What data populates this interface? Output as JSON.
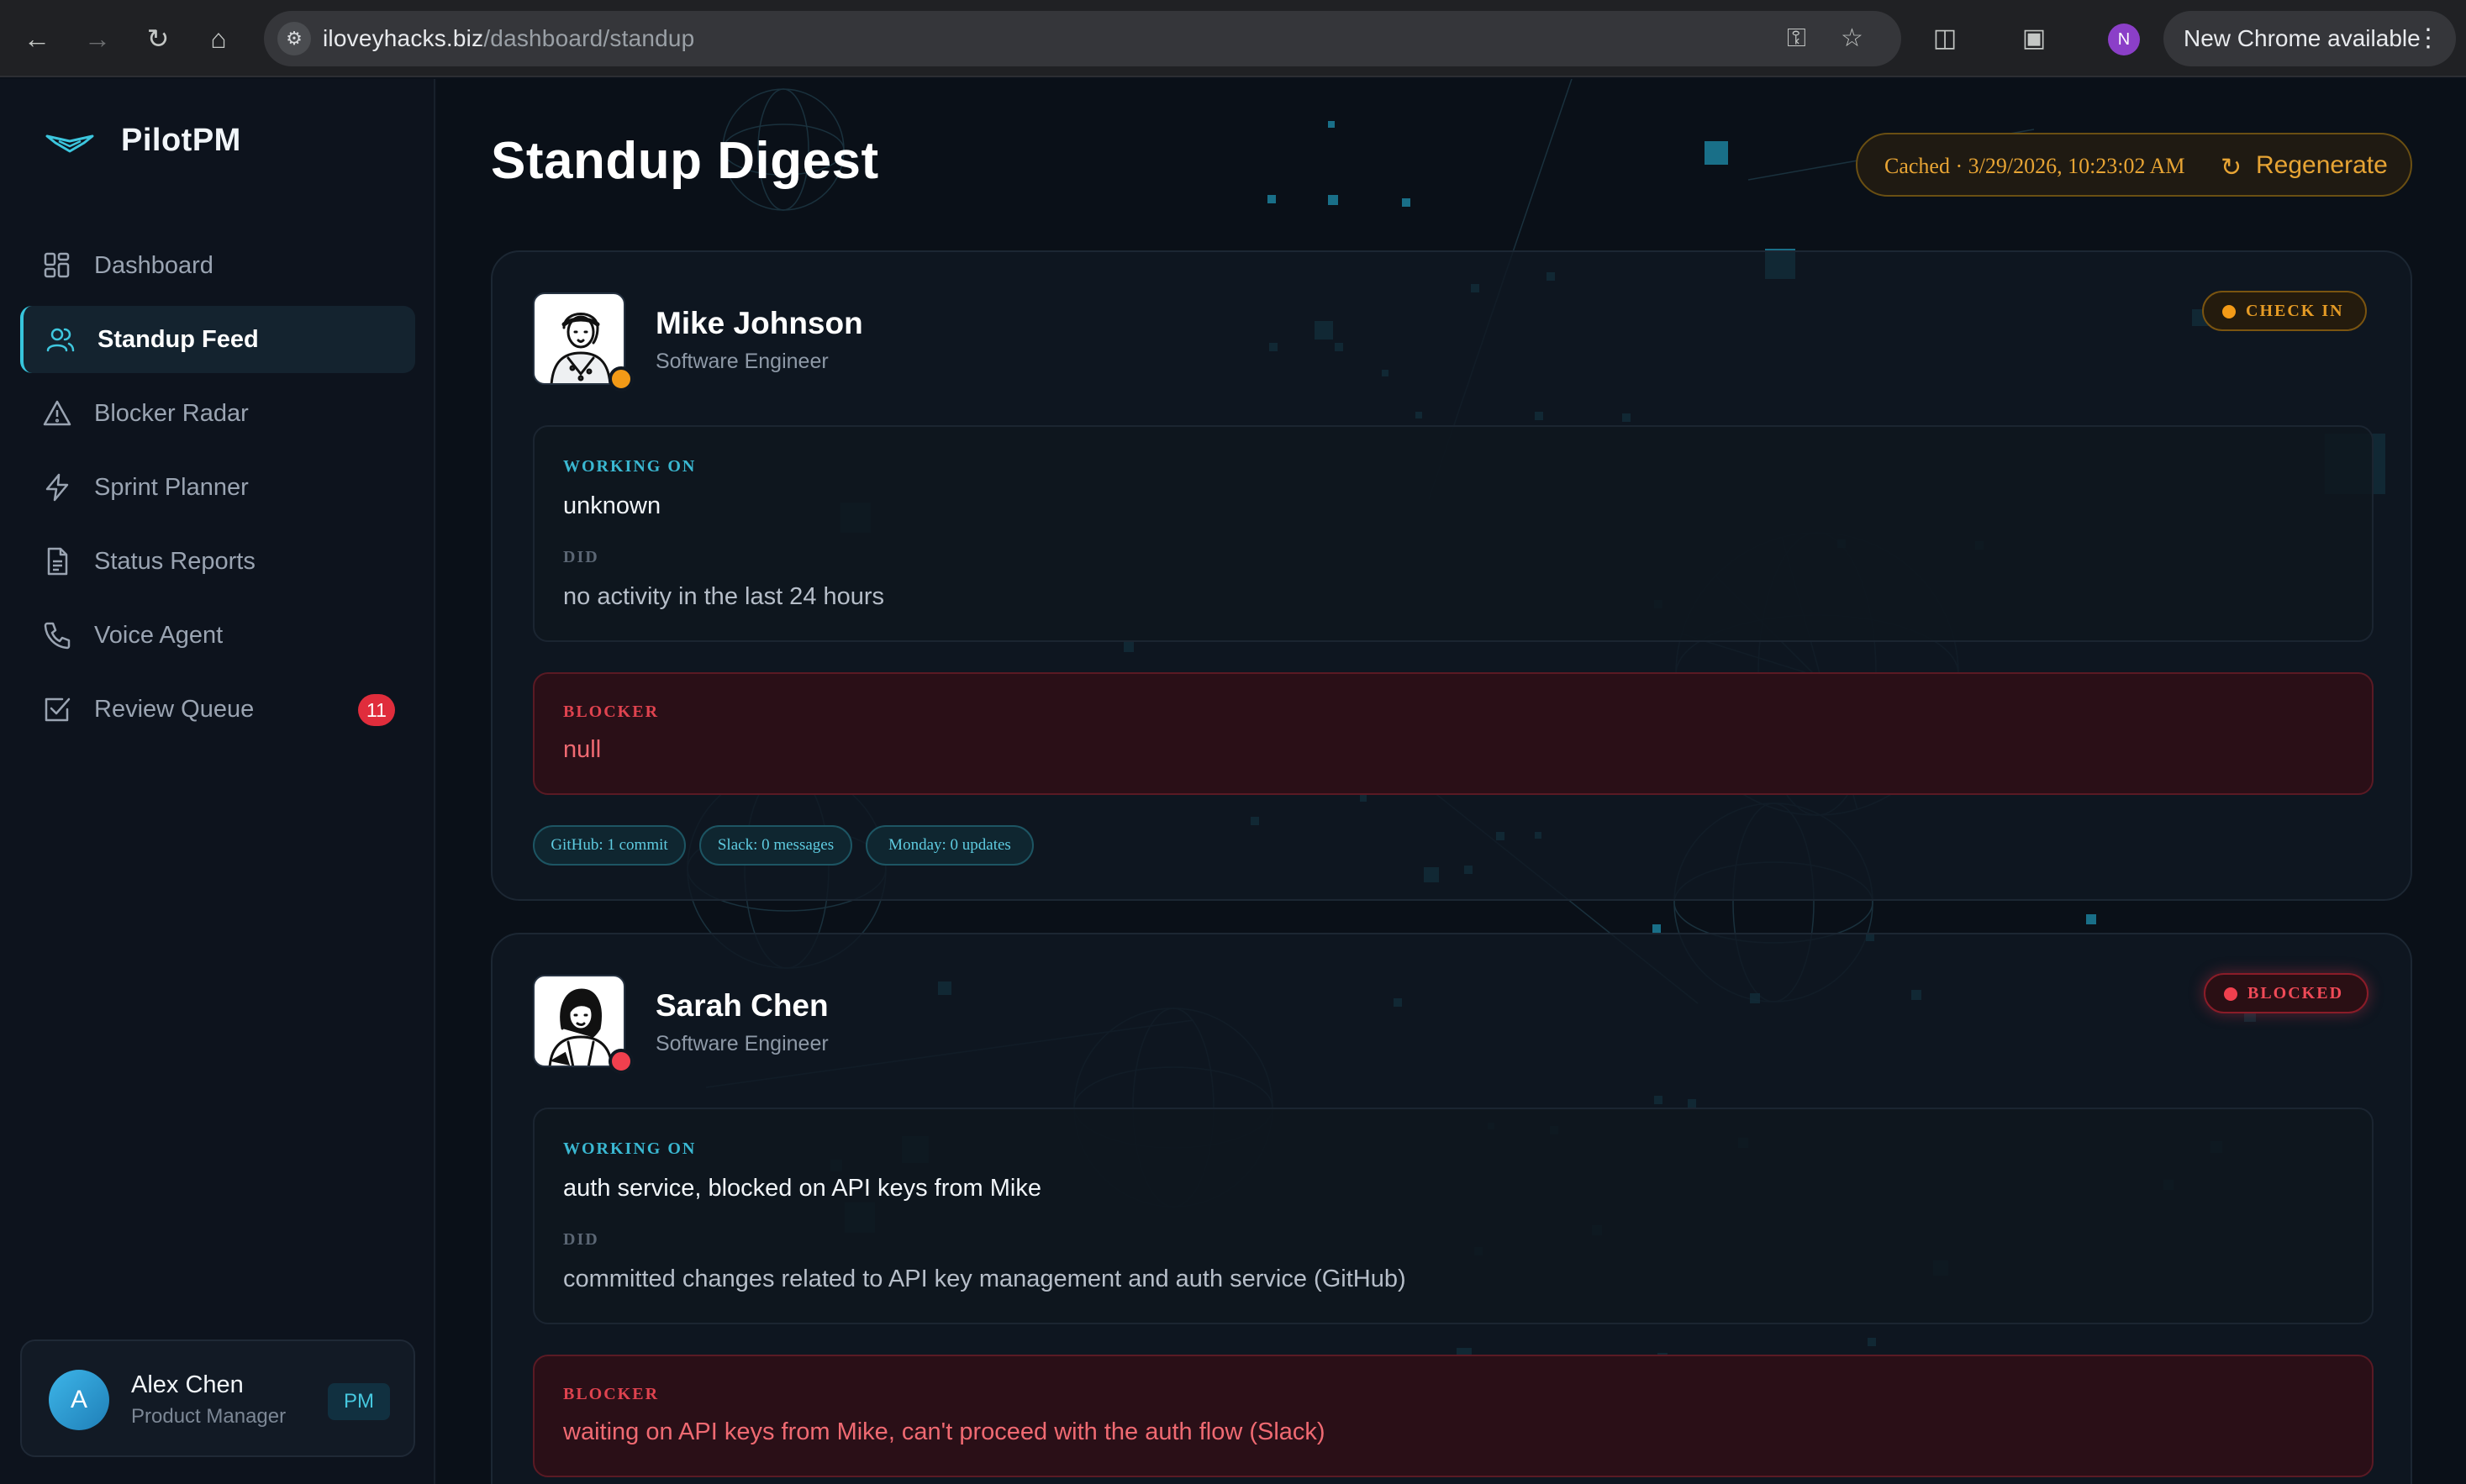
{
  "browser": {
    "url_host": "iloveyhacks.biz",
    "url_path": "/dashboard/standup",
    "profile_initial": "N",
    "update_label": "New Chrome available"
  },
  "sidebar": {
    "brand": "PilotPM",
    "items": [
      {
        "label": "Dashboard",
        "icon": "grid-icon"
      },
      {
        "label": "Standup Feed",
        "icon": "users-icon",
        "active": true
      },
      {
        "label": "Blocker Radar",
        "icon": "warning-icon"
      },
      {
        "label": "Sprint Planner",
        "icon": "lightning-icon"
      },
      {
        "label": "Status Reports",
        "icon": "document-icon"
      },
      {
        "label": "Voice Agent",
        "icon": "phone-icon"
      },
      {
        "label": "Review Queue",
        "icon": "checkbox-icon",
        "badge": "11"
      }
    ],
    "user": {
      "initial": "A",
      "name": "Alex Chen",
      "role": "Product Manager",
      "tag": "PM"
    }
  },
  "header": {
    "title": "Standup Digest",
    "cache_text": "Cached · 3/29/2026, 10:23:02 AM",
    "regenerate_label": "Regenerate"
  },
  "standups": [
    {
      "name": "Mike Johnson",
      "role": "Software Engineer",
      "status": "CHECK IN",
      "status_color": "#f29a17",
      "working_on_label": "WORKING ON",
      "working_on": "unknown",
      "did_label": "DID",
      "did": "no activity in the last 24 hours",
      "blocker_label": "BLOCKER",
      "blocker": "null",
      "sources": [
        "GitHub: 1 commit",
        "Slack: 0 messages",
        "Monday: 0 updates"
      ]
    },
    {
      "name": "Sarah Chen",
      "role": "Software Engineer",
      "status": "BLOCKED",
      "status_color": "#f0404e",
      "working_on_label": "WORKING ON",
      "working_on": "auth service, blocked on API keys from Mike",
      "did_label": "DID",
      "did": "committed changes related to API key management and auth service (GitHub)",
      "blocker_label": "BLOCKER",
      "blocker": "waiting on API keys from Mike, can't proceed with the auth flow (Slack)"
    }
  ]
}
